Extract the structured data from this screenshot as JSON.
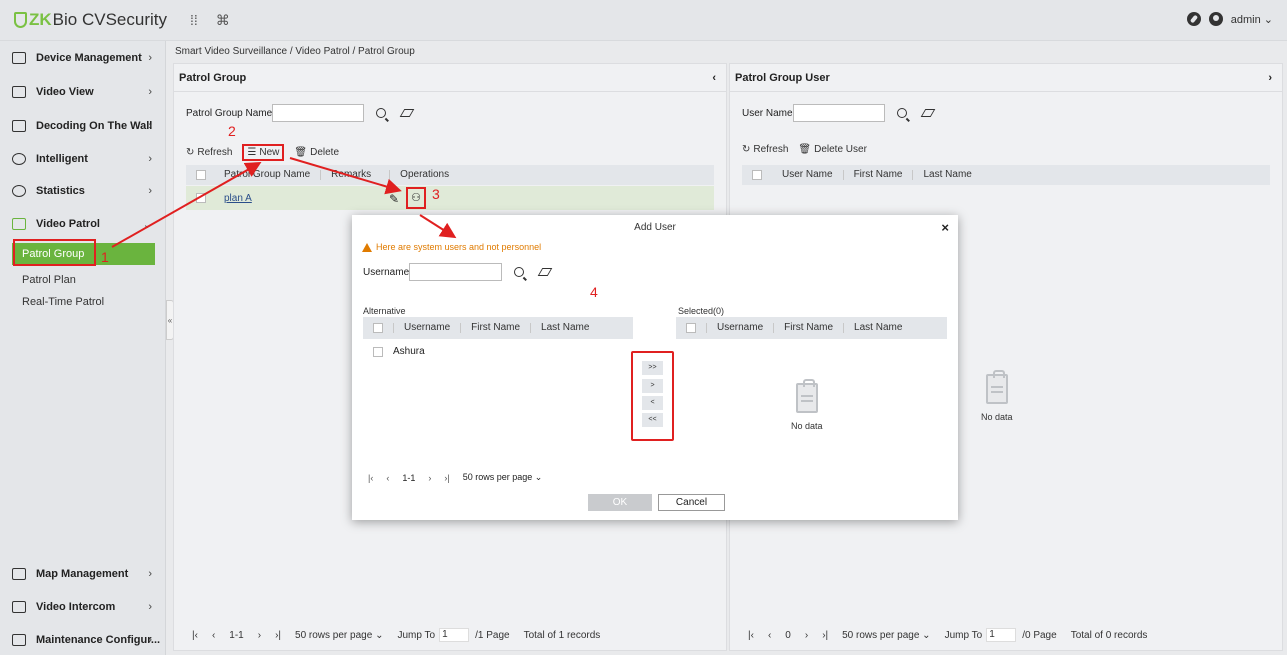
{
  "app": {
    "logo_zk": "ZK",
    "logo_rest": "Bio CVSecurity",
    "user": "admin ⌄"
  },
  "top_icons": [
    "grid-icon",
    "command-icon"
  ],
  "sidebar": {
    "items": [
      {
        "label": "Device Management",
        "icon": "device-icon"
      },
      {
        "label": "Video View",
        "icon": "video-view-icon"
      },
      {
        "label": "Decoding On The Wall",
        "icon": "decoding-icon"
      },
      {
        "label": "Intelligent",
        "icon": "intelligent-icon"
      },
      {
        "label": "Statistics",
        "icon": "statistics-icon"
      },
      {
        "label": "Video Patrol",
        "icon": "patrol-icon"
      },
      {
        "label": "Map Management",
        "icon": "map-icon"
      },
      {
        "label": "Video Intercom",
        "icon": "intercom-icon"
      },
      {
        "label": "Maintenance Configur...",
        "icon": "maintenance-icon"
      }
    ],
    "sub_items": [
      "Patrol Group",
      "Patrol Plan",
      "Real-Time Patrol"
    ]
  },
  "breadcrumb": "Smart Video Surveillance / Video Patrol / Patrol Group",
  "left_panel": {
    "title": "Patrol Group",
    "search_label": "Patrol Group Name",
    "toolbar": {
      "refresh": "Refresh",
      "new": "New",
      "delete": "Delete"
    },
    "columns": [
      "Patrol Group Name",
      "Remarks",
      "Operations"
    ],
    "rows": [
      {
        "name": "plan A"
      }
    ],
    "pager": {
      "range": "1-1",
      "rows_per_page": "50 rows per page",
      "jump_to": "Jump To",
      "jump_value": "1",
      "pages": "/1 Page",
      "total": "Total of 1 records"
    }
  },
  "right_panel": {
    "title": "Patrol Group User",
    "search_label": "User Name",
    "toolbar": {
      "refresh": "Refresh",
      "delete": "Delete User"
    },
    "columns": [
      "User Name",
      "First Name",
      "Last Name"
    ],
    "no_data": "No data",
    "pager": {
      "range": "0",
      "rows_per_page": "50 rows per page",
      "jump_to": "Jump To",
      "jump_value": "1",
      "pages": "/0 Page",
      "total": "Total of 0 records"
    }
  },
  "modal": {
    "title": "Add User",
    "warning": "Here are system users and not personnel",
    "search_label": "Username",
    "alternative_label": "Alternative",
    "selected_label": "Selected(0)",
    "columns": [
      "Username",
      "First Name",
      "Last Name"
    ],
    "alternative_rows": [
      {
        "username": "Ashura"
      }
    ],
    "no_data": "No data",
    "transfer": {
      "all_right": ">>",
      "right": ">",
      "left": "<",
      "all_left": "<<"
    },
    "pager": {
      "range": "1-1",
      "rows_per_page": "50 rows per page"
    },
    "ok": "OK",
    "cancel": "Cancel"
  },
  "annotations": [
    "1",
    "2",
    "3",
    "4"
  ],
  "colors": {
    "accent": "#6ab43e",
    "annotation": "#e02020",
    "warning": "#e07b00"
  }
}
